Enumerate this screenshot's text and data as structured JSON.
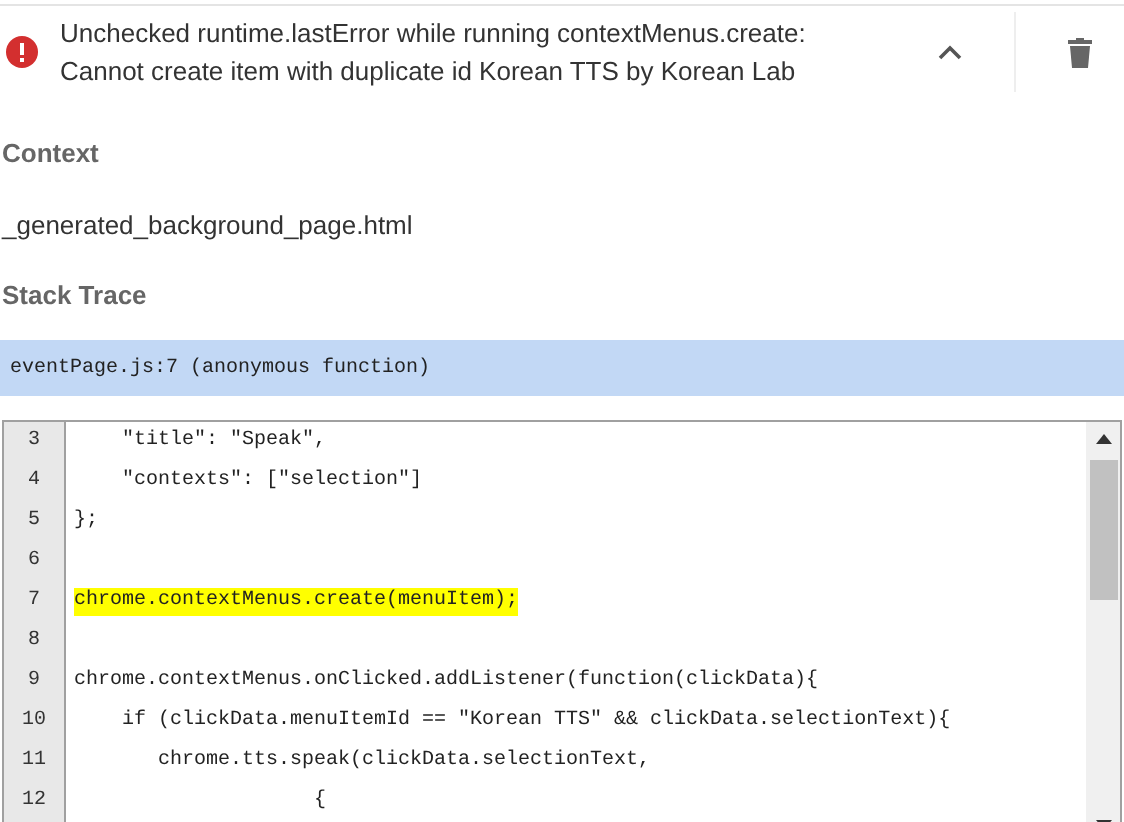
{
  "error": {
    "message_lines": [
      "Unchecked runtime.lastError while running contextMenus.create:",
      "Cannot create item with duplicate id Korean TTS by Korean Lab"
    ],
    "expanded": true
  },
  "context": {
    "heading": "Context",
    "value": "_generated_background_page.html"
  },
  "stack_trace": {
    "heading": "Stack Trace",
    "frames": [
      {
        "text": "eventPage.js:7 (anonymous function)",
        "selected": true
      }
    ]
  },
  "code": {
    "lines": [
      {
        "number": "3",
        "text": "    \"title\": \"Speak\",",
        "highlighted": false
      },
      {
        "number": "4",
        "text": "    \"contexts\": [\"selection\"]",
        "highlighted": false
      },
      {
        "number": "5",
        "text": "};",
        "highlighted": false
      },
      {
        "number": "6",
        "highlighted": false
      },
      {
        "number": "7",
        "text": "chrome.contextMenus.create(menuItem);",
        "highlighted": true
      },
      {
        "number": "8",
        "highlighted": false
      },
      {
        "number": "9",
        "text": "chrome.contextMenus.onClicked.addListener(function(clickData){",
        "highlighted": false
      },
      {
        "number": "10",
        "text": "    if (clickData.menuItemId == \"Korean TTS\" && clickData.selectionText){",
        "highlighted": false
      },
      {
        "number": "11",
        "text": "       chrome.tts.speak(clickData.selectionText,",
        "highlighted": false
      },
      {
        "number": "12",
        "text": "                    {",
        "highlighted": false
      }
    ]
  }
}
